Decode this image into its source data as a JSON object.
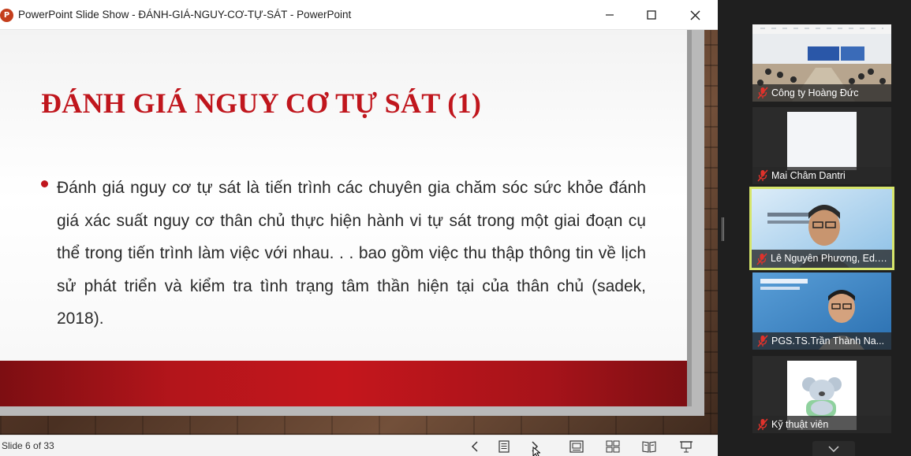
{
  "window": {
    "app_name": "PowerPoint Slide Show",
    "title": "PowerPoint Slide Show  -  ĐÁNH-GIÁ-NGUY-CƠ-TỰ-SÁT - PowerPoint",
    "icon_letter": "P"
  },
  "slide": {
    "title": "ĐÁNH GIÁ NGUY CƠ TỰ SÁT (1)",
    "body": "Đánh giá nguy cơ tự sát là tiến trình các chuyên gia chăm sóc sức khỏe đánh giá xác suất nguy cơ thân chủ thực hiện hành vi tự sát trong một giai đoạn cụ thể trong tiến trình làm việc với nhau. . . bao gồm việc thu thập thông tin về lịch sử phát triển và kiểm tra tình trạng tâm thần hiện tại của thân chủ (sadek, 2018).",
    "title_color": "#c0161d",
    "band_color": "#c4161c"
  },
  "statusbar": {
    "slide_counter": "Slide 6 of 33"
  },
  "participants": [
    {
      "name": "Công ty Hoàng Đức",
      "muted": true,
      "active": false
    },
    {
      "name": "Mai Châm Dantri",
      "muted": true,
      "active": false
    },
    {
      "name": "Lê Nguyên Phương, Ed.D., ...",
      "muted": true,
      "active": true
    },
    {
      "name": "PGS.TS.Trần Thành Na...",
      "muted": true,
      "active": false
    },
    {
      "name": "Kỹ thuật viên",
      "muted": true,
      "active": false
    }
  ],
  "colors": {
    "active_speaker_outline": "#d7e66b",
    "muted_icon": "#e0322b"
  }
}
